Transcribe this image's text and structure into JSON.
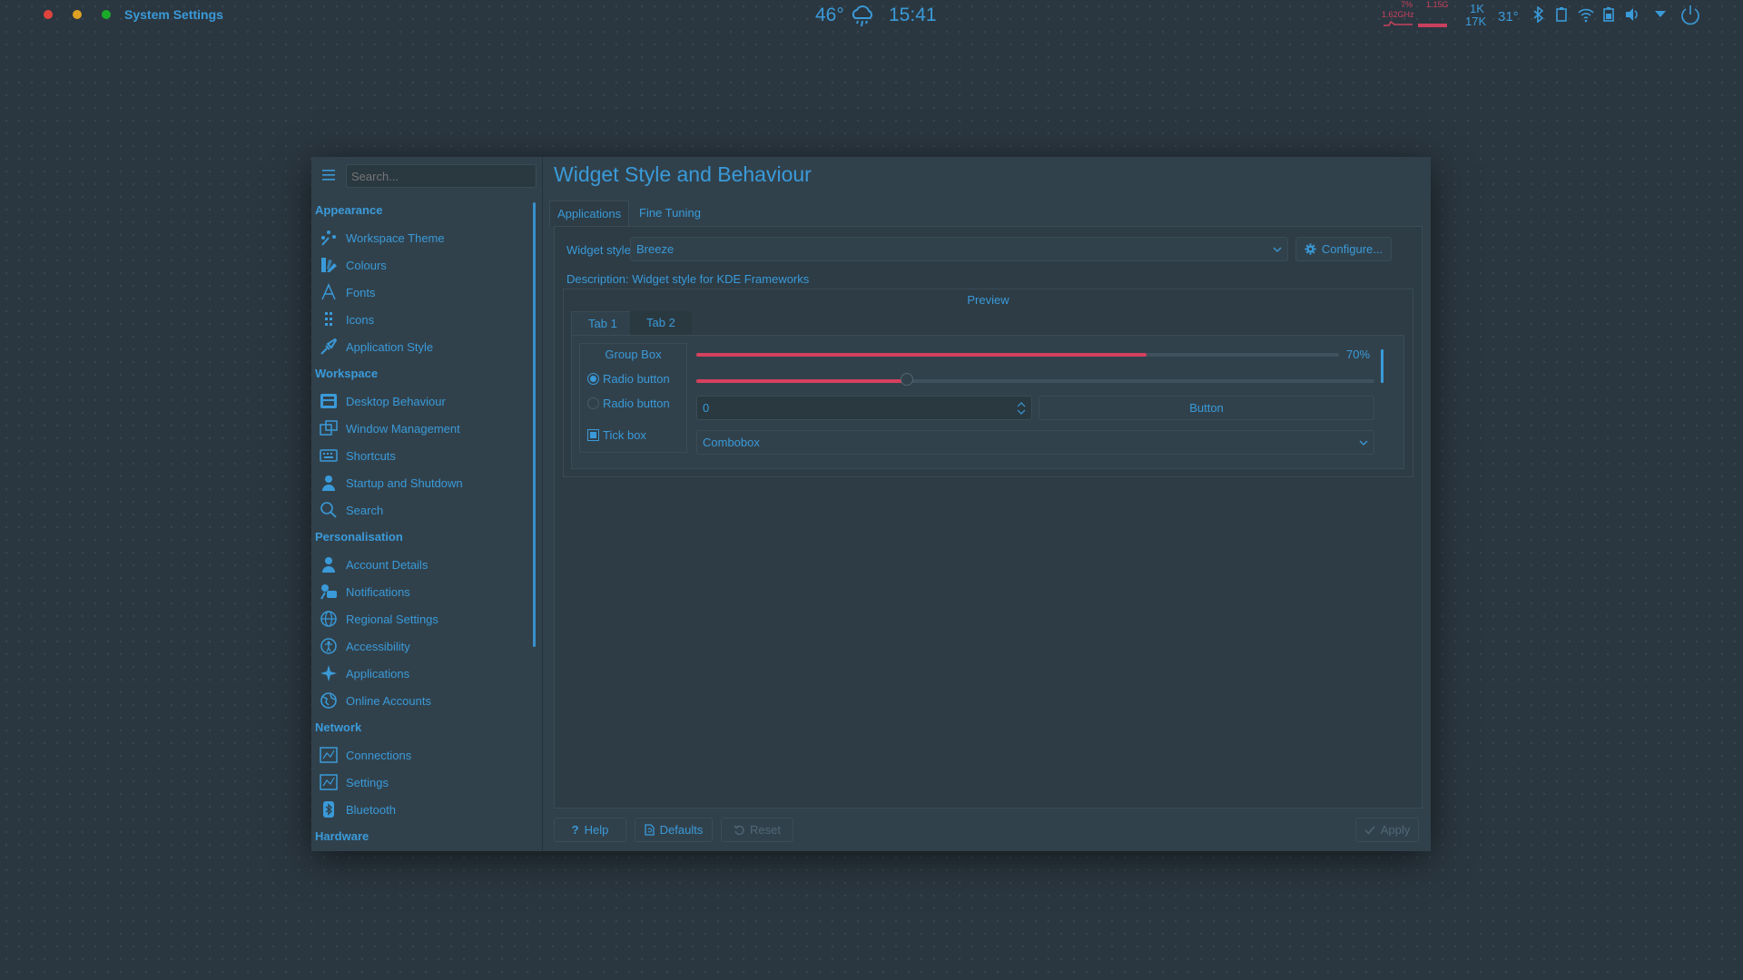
{
  "window_controls": {
    "close_color": "#e0443e",
    "minimize_color": "#dea123",
    "maximize_color": "#1aab29"
  },
  "panel": {
    "app_title": "System Settings",
    "weather_temp": "46°",
    "weather_icon": "rain-cloud-icon",
    "clock": "15:41",
    "cpu_percent": "7%",
    "cpu_freq": "1.62GHz",
    "mem": "1.15G",
    "net_up": "1K",
    "net_down": "17K",
    "temperature": "31°",
    "tray_icons": [
      "bluetooth-icon",
      "clipboard-icon",
      "wifi-icon",
      "battery-icon",
      "volume-icon",
      "expand-arrow-icon",
      "power-icon"
    ]
  },
  "sidebar": {
    "search_placeholder": "Search...",
    "sections": [
      {
        "title": "Appearance",
        "items": [
          {
            "label": "Workspace Theme",
            "icon": "workspace-theme-icon"
          },
          {
            "label": "Colours",
            "icon": "colours-icon"
          },
          {
            "label": "Fonts",
            "icon": "fonts-icon"
          },
          {
            "label": "Icons",
            "icon": "icons-icon"
          },
          {
            "label": "Application Style",
            "icon": "application-style-icon"
          }
        ]
      },
      {
        "title": "Workspace",
        "items": [
          {
            "label": "Desktop Behaviour",
            "icon": "desktop-behaviour-icon"
          },
          {
            "label": "Window Management",
            "icon": "window-management-icon"
          },
          {
            "label": "Shortcuts",
            "icon": "shortcuts-icon"
          },
          {
            "label": "Startup and Shutdown",
            "icon": "startup-shutdown-icon"
          },
          {
            "label": "Search",
            "icon": "search-icon"
          }
        ]
      },
      {
        "title": "Personalisation",
        "items": [
          {
            "label": "Account Details",
            "icon": "account-details-icon"
          },
          {
            "label": "Notifications",
            "icon": "notifications-icon"
          },
          {
            "label": "Regional Settings",
            "icon": "regional-settings-icon"
          },
          {
            "label": "Accessibility",
            "icon": "accessibility-icon"
          },
          {
            "label": "Applications",
            "icon": "applications-icon"
          },
          {
            "label": "Online Accounts",
            "icon": "online-accounts-icon"
          }
        ]
      },
      {
        "title": "Network",
        "items": [
          {
            "label": "Connections",
            "icon": "connections-icon"
          },
          {
            "label": "Settings",
            "icon": "network-settings-icon"
          },
          {
            "label": "Bluetooth",
            "icon": "bluetooth-icon"
          }
        ]
      },
      {
        "title": "Hardware",
        "items": []
      }
    ]
  },
  "main": {
    "title": "Widget Style and Behaviour",
    "tabs": [
      {
        "label": "Applications"
      },
      {
        "label": "Fine Tuning"
      }
    ],
    "widget_style_label": "Widget style:",
    "widget_style_value": "Breeze",
    "configure_label": "Configure...",
    "description": "Description: Widget style for KDE Frameworks",
    "preview": {
      "title": "Preview",
      "tabs": [
        {
          "label": "Tab 1"
        },
        {
          "label": "Tab 2"
        }
      ],
      "group_box_title": "Group Box",
      "radio1_label": "Radio button",
      "radio2_label": "Radio button",
      "tickbox_label": "Tick box",
      "progress_value": 70,
      "progress_label": "70%",
      "slider_value": 0.31,
      "spinbox_value": "0",
      "button_label": "Button",
      "combobox_value": "Combobox"
    }
  },
  "footer": {
    "help_label": "Help",
    "defaults_label": "Defaults",
    "reset_label": "Reset",
    "apply_label": "Apply"
  },
  "colors": {
    "accent": "#3a9ad9",
    "progress": "#d6405e",
    "background": "#2b3740",
    "window": "#31414b"
  }
}
